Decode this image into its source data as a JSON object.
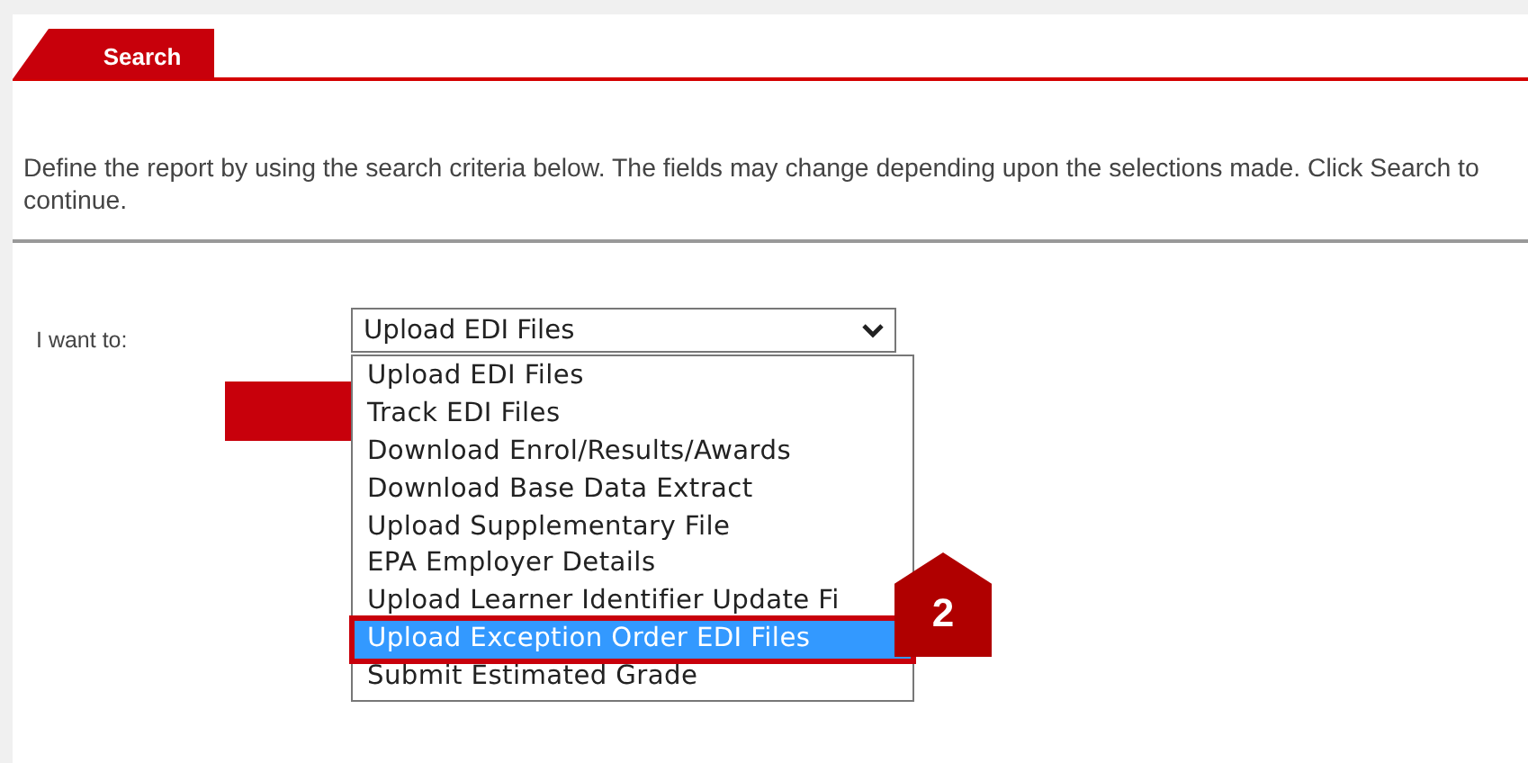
{
  "tabs": [
    {
      "label": "Search",
      "selected": true
    }
  ],
  "description": "Define the report by using the search criteria below. The fields may change depending upon the selections made. Click Search to continue.",
  "form": {
    "label": "I want to:",
    "select": {
      "value": "Upload EDI Files",
      "expanded": true
    },
    "options": [
      {
        "label": "Upload EDI Files",
        "selected": false
      },
      {
        "label": "Track EDI Files",
        "selected": false
      },
      {
        "label": "Download Enrol/Results/Awards",
        "selected": false
      },
      {
        "label": "Download Base Data Extract",
        "selected": false
      },
      {
        "label": "Upload Supplementary File",
        "selected": false
      },
      {
        "label": "EPA Employer Details",
        "selected": false
      },
      {
        "label": "Upload Learner Identifier Update Fi",
        "selected": false
      },
      {
        "label": "Upload Exception Order EDI Files",
        "selected": true
      },
      {
        "label": "Submit Estimated Grade",
        "selected": false
      }
    ]
  },
  "callout": {
    "label": "2"
  }
}
